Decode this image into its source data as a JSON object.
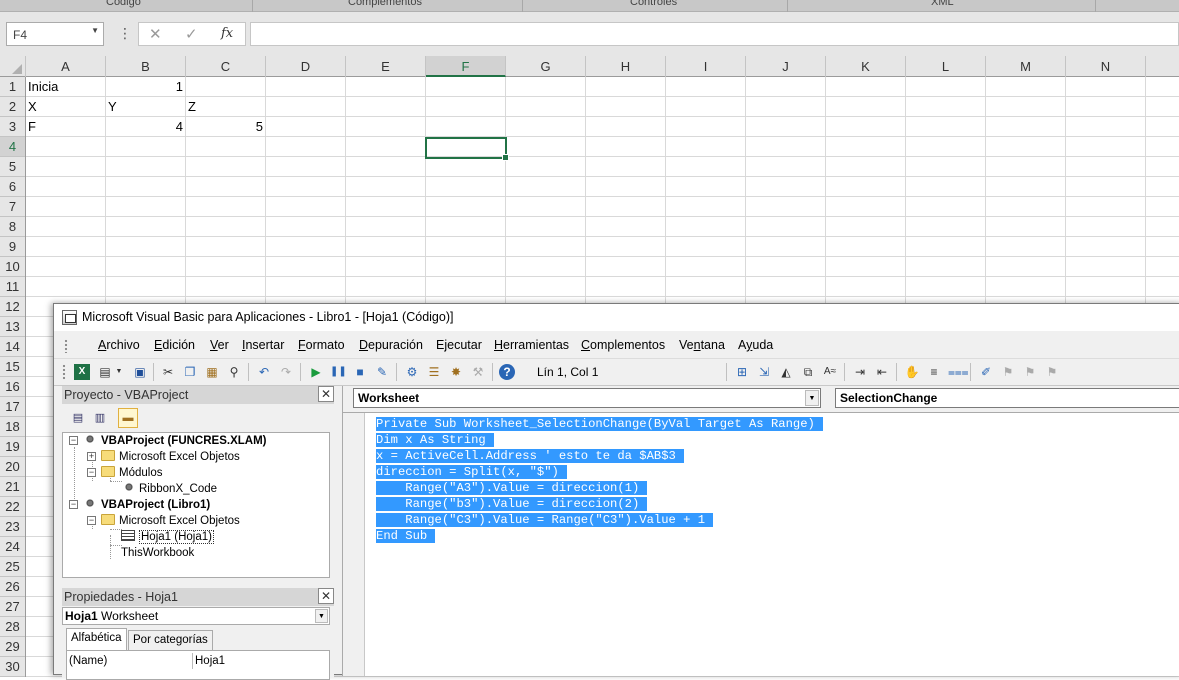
{
  "ribbon_groups": [
    "Código",
    "Complementos",
    "Controles",
    "XML"
  ],
  "name_box": {
    "value": "F4"
  },
  "formula_bar": {
    "cancel_icon": "✕",
    "enter_icon": "✓",
    "fx_label": "fx",
    "value": ""
  },
  "sheet": {
    "columns": [
      "A",
      "B",
      "C",
      "D",
      "E",
      "F",
      "G",
      "H",
      "I",
      "J",
      "K",
      "L",
      "M",
      "N"
    ],
    "active_column": "F",
    "rows": [
      "1",
      "2",
      "3",
      "4",
      "5",
      "6",
      "7",
      "8",
      "9",
      "10",
      "11",
      "12",
      "13",
      "14",
      "15",
      "16",
      "17",
      "18",
      "19",
      "20",
      "21",
      "22",
      "23",
      "24",
      "25",
      "26",
      "27",
      "28",
      "29",
      "30"
    ],
    "active_row": "4",
    "cells": {
      "A1": "Inicia",
      "B1": "1",
      "A2": "X",
      "B2": "Y",
      "C2": "Z",
      "A3": "F",
      "B3": "4",
      "C3": "5"
    }
  },
  "vbe": {
    "title": "Microsoft Visual Basic para Aplicaciones - Libro1 - [Hoja1 (Código)]",
    "menu": [
      {
        "label": "Archivo",
        "u": "A"
      },
      {
        "label": "Edición",
        "u": "E"
      },
      {
        "label": "Ver",
        "u": "V"
      },
      {
        "label": "Insertar",
        "u": "I"
      },
      {
        "label": "Formato",
        "u": "F"
      },
      {
        "label": "Depuración",
        "u": "D"
      },
      {
        "label": "Ejecutar",
        "u": "j"
      },
      {
        "label": "Herramientas",
        "u": "H"
      },
      {
        "label": "Complementos",
        "u": "C"
      },
      {
        "label": "Ventana",
        "u": "n"
      },
      {
        "label": "Ayuda",
        "u": "y"
      }
    ],
    "cursor_position": "Lín 1, Col 1",
    "project": {
      "title": "Proyecto - VBAProject",
      "tree": {
        "p1": "VBAProject (FUNCRES.XLAM)",
        "p1_f1": "Microsoft Excel Objetos",
        "p1_f2": "Módulos",
        "p1_m1": "RibbonX_Code",
        "p2": "VBAProject (Libro1)",
        "p2_f1": "Microsoft Excel Objetos",
        "p2_s1": "Hoja1 (Hoja1)",
        "p2_s2": "ThisWorkbook"
      }
    },
    "properties": {
      "title": "Propiedades - Hoja1",
      "object_name": "Hoja1",
      "object_type": "Worksheet",
      "tab_alpha": "Alfabética",
      "tab_cat": "Por categorías",
      "row_name": "(Name)",
      "row_value": "Hoja1"
    },
    "code": {
      "object_combo": "Worksheet",
      "proc_combo": "SelectionChange",
      "lines": [
        "Private Sub Worksheet_SelectionChange(ByVal Target As Range)",
        "Dim x As String",
        "x = ActiveCell.Address ' esto te da $AB$3",
        "direccion = Split(x, \"$\")",
        "    Range(\"A3\").Value = direccion(1)",
        "    Range(\"b3\").Value = direccion(2)",
        "    Range(\"C3\").Value = Range(\"C3\").Value + 1",
        "End Sub"
      ]
    }
  }
}
